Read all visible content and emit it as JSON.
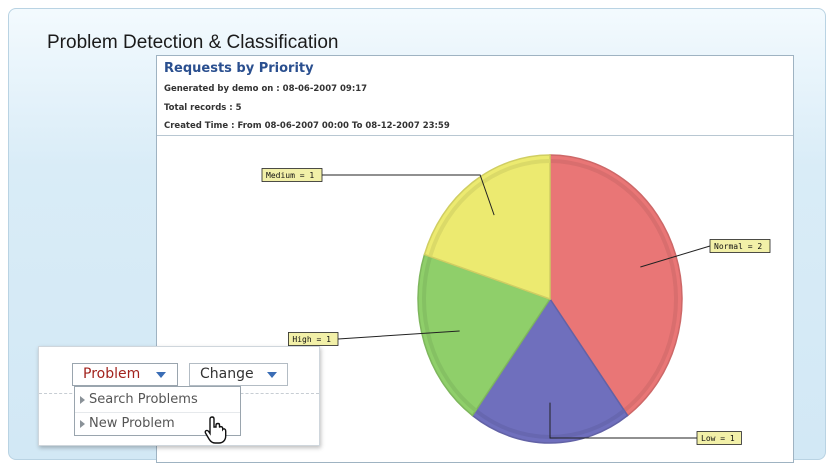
{
  "page": {
    "section_title": "Problem Detection & Classification"
  },
  "report": {
    "title": "Requests by Priority",
    "generated_by": "Generated by demo  on : 08-06-2007 09:17",
    "total_records": "Total records : 5",
    "created_time": "Created Time : From 08-06-2007 00:00 To 08-12-2007 23:59"
  },
  "menu": {
    "tabs": [
      {
        "label": "Problem",
        "active": true
      },
      {
        "label": "Change",
        "active": false
      }
    ],
    "dropdown_items": [
      "Search Problems",
      "New Problem"
    ],
    "highlighted_item": "New Problem"
  },
  "chart_data": {
    "type": "pie",
    "title": "Requests by Priority",
    "slices": [
      {
        "label": "Normal",
        "value": 2,
        "display": "Normal = 2",
        "color": "#e97676"
      },
      {
        "label": "Low",
        "value": 1,
        "display": "Low = 1",
        "color": "#6f6fbd"
      },
      {
        "label": "High",
        "value": 1,
        "display": "High = 1",
        "color": "#8fcf6a"
      },
      {
        "label": "Medium",
        "value": 1,
        "display": "Medium = 1",
        "color": "#ecea70"
      }
    ]
  },
  "colors": {
    "panel_bg": "#d2e8f5",
    "title_blue": "#2a4f8f",
    "active_tab_red": "#a2231d",
    "label_box_fill": "#f2f0a8"
  }
}
